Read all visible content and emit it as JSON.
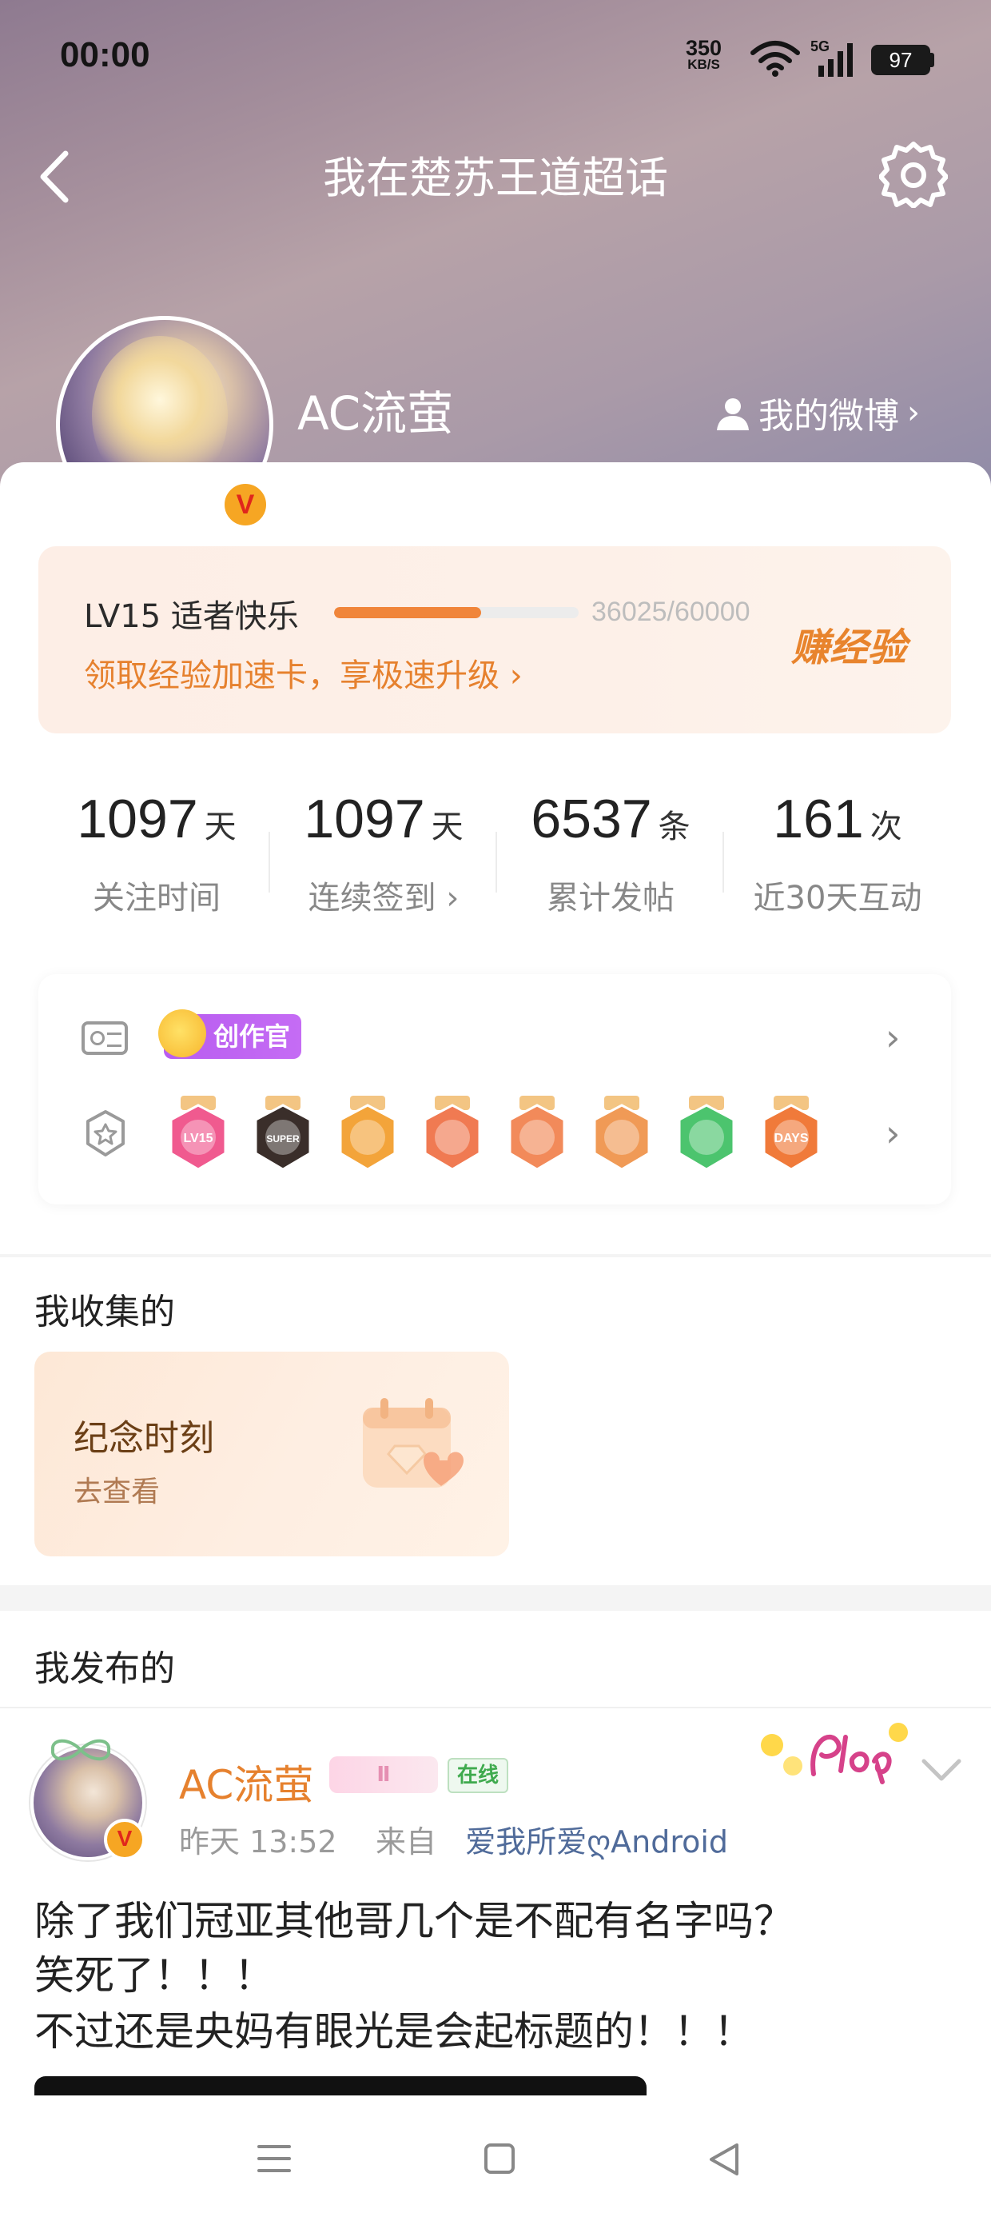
{
  "status_bar": {
    "time": "00:00",
    "net_speed": "350",
    "net_unit": "KB/S",
    "network": "5G",
    "battery": "97"
  },
  "nav": {
    "title": "我在楚苏王道超话",
    "back_icon": "chevron-left-icon",
    "settings_icon": "gear-icon"
  },
  "profile": {
    "username": "AC流萤",
    "verified_badge": "V",
    "my_weibo_label": "我的微博"
  },
  "level": {
    "label": "LV15 适者快乐",
    "progress_text": "36025/60000",
    "progress_fraction": 0.6004,
    "boost_link": "领取经验加速卡，享极速升级",
    "earn_button": "赚经验"
  },
  "stats": [
    {
      "value": "1097",
      "unit": "天",
      "label": "关注时间"
    },
    {
      "value": "1097",
      "unit": "天",
      "label": "连续签到"
    },
    {
      "value": "6537",
      "unit": "条",
      "label": "累计发帖"
    },
    {
      "value": "161",
      "unit": "次",
      "label": "近30天互动"
    }
  ],
  "badges": {
    "creator_tag": "创作官",
    "medals": [
      {
        "name": "lv15-medal",
        "text": "LV15",
        "color": "#f05a8f"
      },
      {
        "name": "super-medal",
        "text": "SUPER",
        "color": "#3a2e2a"
      },
      {
        "name": "crown-medal",
        "text": "",
        "color": "#f3a43a"
      },
      {
        "name": "cat-medal-1",
        "text": "",
        "color": "#f07a52"
      },
      {
        "name": "cat-medal-2",
        "text": "",
        "color": "#f28a5a"
      },
      {
        "name": "cat-medal-3",
        "text": "",
        "color": "#f09a56"
      },
      {
        "name": "hand-medal",
        "text": "",
        "color": "#4cc46e"
      },
      {
        "name": "100days-medal",
        "text": "DAYS",
        "color": "#f07a3a"
      }
    ]
  },
  "collect": {
    "title": "我收集的",
    "card_title": "纪念时刻",
    "card_link": "去查看"
  },
  "posts": {
    "title": "我发布的",
    "item": {
      "username": "AC流萤",
      "level_badge": "Ⅱ",
      "online_tag": "在线",
      "time": "昨天 13:52",
      "from_label": "来自",
      "source": "爱我所爱ღAndroid",
      "lines": [
        "除了我们冠亚其他哥几个是不配有名字吗？",
        "笑死了！！！",
        "不过还是央妈有眼光是会起标题的！！！"
      ]
    }
  },
  "colors": {
    "accent_orange": "#e6812e",
    "online_green": "#3faa4e",
    "creator_purple": "#b85cf0"
  }
}
